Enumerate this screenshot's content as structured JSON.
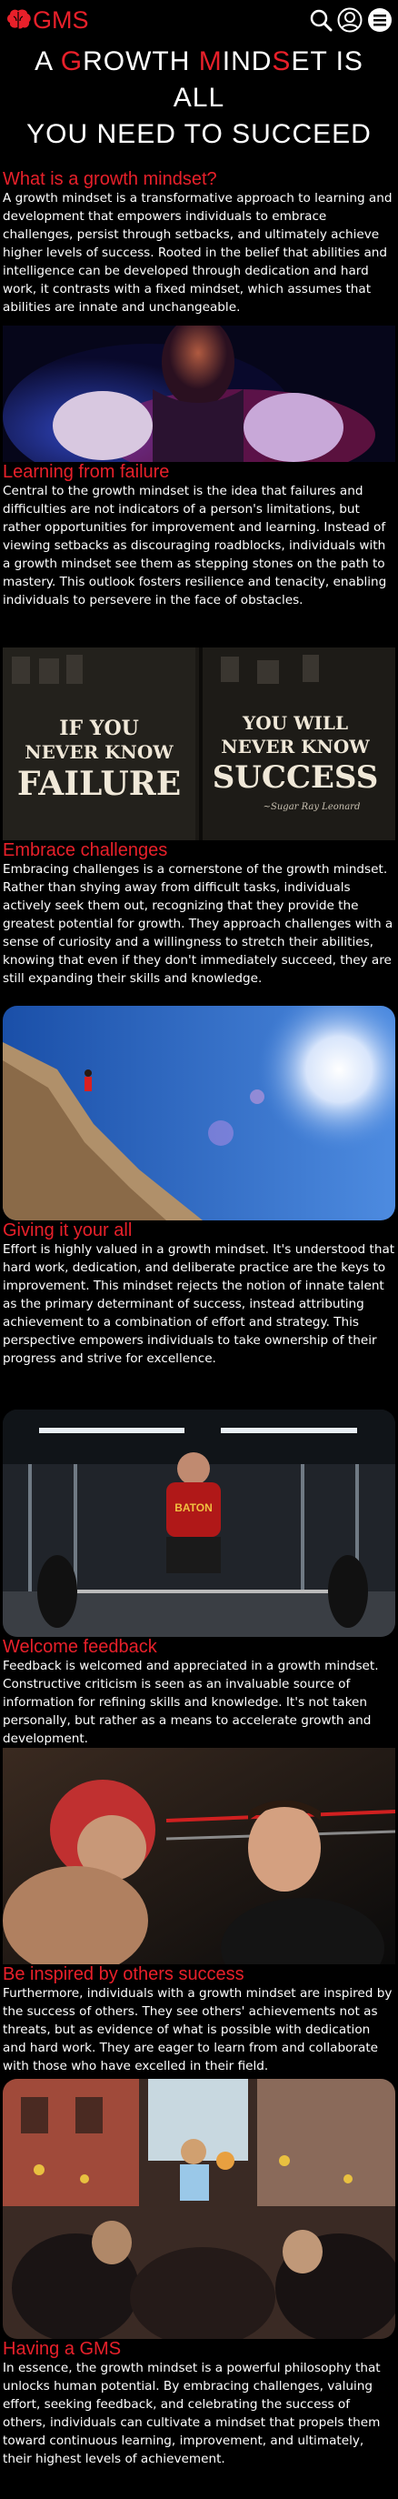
{
  "brand": {
    "name": "GMS",
    "accent": "#e8202a"
  },
  "nav": {
    "icons": [
      "search-icon",
      "user-icon",
      "menu-icon"
    ]
  },
  "hero": {
    "part1": "A ",
    "g": "G",
    "part2": "ROWTH ",
    "m": "M",
    "part3": "IND",
    "s": "S",
    "part4": "ET IS ALL",
    "line2": "YOU NEED TO SUCCEED"
  },
  "sections": [
    {
      "title": "What is a growth mindset?",
      "text": "A growth mindset is a transformative approach to learning and development that empowers individuals to embrace challenges, persist through setbacks, and ultimately achieve higher levels of success. Rooted in the belief that abilities and intelligence can be developed through dedication and hard work, it contrasts with a fixed mindset, which assumes that abilities are innate and unchangeable."
    },
    {
      "title": "Learning from failure",
      "text": "Central to the growth mindset is the idea that failures and difficulties are not indicators of a person's limitations, but rather opportunities for improvement and learning. Instead of viewing setbacks as discouraging roadblocks, individuals with a growth mindset see them as stepping stones on the path to mastery. This outlook fosters resilience and tenacity, enabling individuals to persevere in the face of obstacles."
    },
    {
      "title": "Embrace challenges",
      "text": "Embracing challenges is a cornerstone of the growth mindset. Rather than shying away from difficult tasks, individuals actively seek them out, recognizing that they provide the greatest potential for growth. They approach challenges with a sense of curiosity and a willingness to stretch their abilities, knowing that even if they don't immediately succeed, they are still expanding their skills and knowledge."
    },
    {
      "title": "Giving it your all",
      "text": "Effort is highly valued in a growth mindset. It's understood that hard work, dedication, and deliberate practice are the keys to improvement. This mindset rejects the notion of innate talent as the primary determinant of success, instead attributing achievement to a combination of effort and strategy. This perspective empowers individuals to take ownership of their progress and strive for excellence."
    },
    {
      "title": "Welcome feedback",
      "text": "Feedback is welcomed and appreciated in a growth mindset. Constructive criticism is seen as an invaluable source of information for refining skills and knowledge. It's not taken personally, but rather as a means to accelerate growth and development."
    },
    {
      "title": "Be inspired by others success",
      "text": "Furthermore, individuals with a growth mindset are inspired by the success of others. They see others' achievements not as threats, but as evidence of what is possible with dedication and hard work. They are eager to learn from and collaborate with those who have excelled in their field."
    },
    {
      "title": "Having a GMS",
      "text": "In essence, the growth mindset is a powerful philosophy that unlocks human potential. By embracing challenges, valuing effort, seeking feedback, and celebrating the success of others, individuals can cultivate a mindset that propels them toward continuous learning, improvement, and ultimately, their highest levels of achievement."
    }
  ],
  "poster": {
    "left_line1": "IF YOU",
    "left_line2": "NEVER KNOW",
    "left_line3": "FAILURE",
    "right_line1": "YOU WILL",
    "right_line2": "NEVER KNOW",
    "right_line3": "SUCCESS",
    "signature": "~Sugar Ray Leonard"
  },
  "gym_banner": "BATON"
}
